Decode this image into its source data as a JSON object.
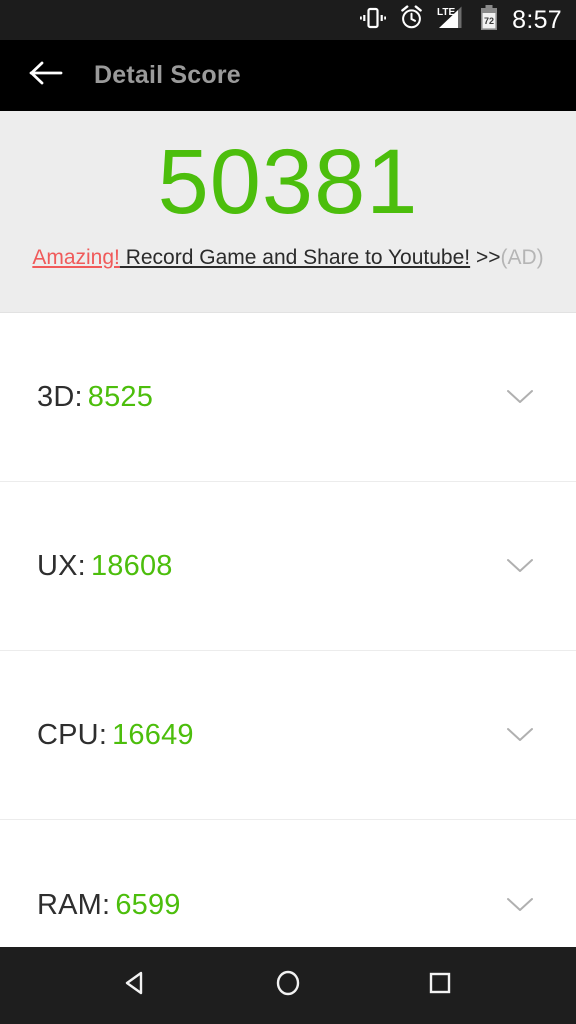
{
  "status_bar": {
    "icons": [
      {
        "name": "vibrate-icon"
      },
      {
        "name": "alarm-clock-icon"
      },
      {
        "name": "lte-signal-icon",
        "label": "LTE"
      },
      {
        "name": "battery-icon",
        "label": "72"
      }
    ],
    "time": "8:57"
  },
  "toolbar": {
    "back_icon": "back-arrow-icon",
    "title": "Detail Score"
  },
  "score_header": {
    "total_score": "50381",
    "ad": {
      "highlight": "Amazing!",
      "body": " Record Game and Share to Youtube!",
      "arrows": " >>",
      "tag": "(AD)"
    }
  },
  "score_rows": [
    {
      "label": "3D:",
      "value": "8525",
      "chevron": "chevron-down-icon"
    },
    {
      "label": "UX:",
      "value": "18608",
      "chevron": "chevron-down-icon"
    },
    {
      "label": "CPU:",
      "value": "16649",
      "chevron": "chevron-down-icon"
    },
    {
      "label": "RAM:",
      "value": "6599",
      "chevron": "chevron-down-icon"
    }
  ],
  "nav_bar": {
    "back": "nav-back-icon",
    "home": "nav-home-icon",
    "recents": "nav-recents-icon"
  },
  "colors": {
    "accent_green": "#4cbe0c",
    "ad_red": "#f05a5a",
    "header_bg": "#ededed",
    "toolbar_bg": "#000000",
    "status_bg": "#1c1c1c",
    "nav_bg": "#1e1e1e",
    "title_gray": "#9a9a9a"
  }
}
